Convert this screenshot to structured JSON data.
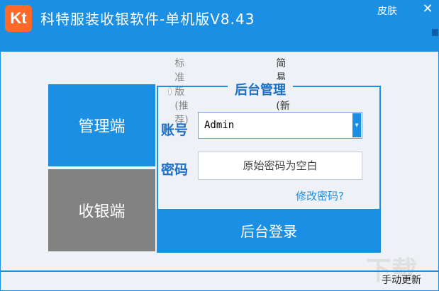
{
  "window": {
    "logo_text": "Kt",
    "title": "科特服装收银软件-单机版V8.43",
    "skin_label": "皮肤",
    "close_glyph": "✕"
  },
  "mode": {
    "standard_label": "标准版(推荐)",
    "simple_label": "简易版(新手)",
    "selected": "simple"
  },
  "panels": {
    "admin_label": "管理端",
    "cashier_label": "收银端"
  },
  "login": {
    "section_title": "后台管理",
    "account_label": "账号",
    "account_value": "Admin",
    "password_label": "密码",
    "password_placeholder": "原始密码为空白",
    "change_password_link": "修改密码?",
    "login_button": "后台登录"
  },
  "footer": {
    "update_link": "手动更新",
    "watermark": "下载"
  },
  "colors": {
    "accent": "#1b8fe3",
    "logo": "#ff6a2a",
    "cashier_panel": "#828282"
  }
}
